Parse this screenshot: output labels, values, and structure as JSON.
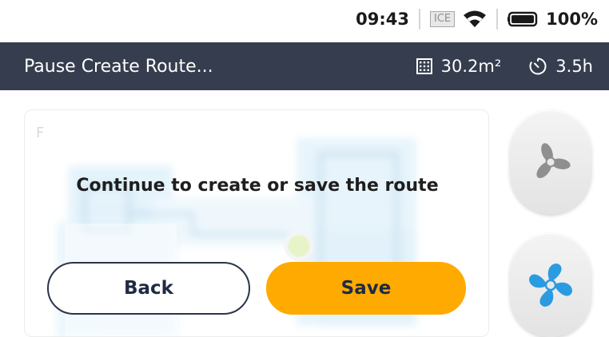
{
  "status": {
    "time": "09:43",
    "network_badge": "ICE",
    "battery": "100%"
  },
  "header": {
    "title": "Pause Create Route...",
    "area_value": "30.2m²",
    "time_value": "3.5h"
  },
  "map": {
    "floor_label": "F"
  },
  "dialog": {
    "message": "Continue to create or save the route",
    "back_label": "Back",
    "save_label": "Save"
  },
  "side_buttons": [
    {
      "icon": "fan-off-icon",
      "active": false
    },
    {
      "icon": "fan-on-icon",
      "active": true
    }
  ],
  "colors": {
    "header_bg": "#363d4f",
    "save_button": "#ffaa00",
    "fan_active": "#2a9be0",
    "fan_inactive": "#8f8f8f"
  }
}
